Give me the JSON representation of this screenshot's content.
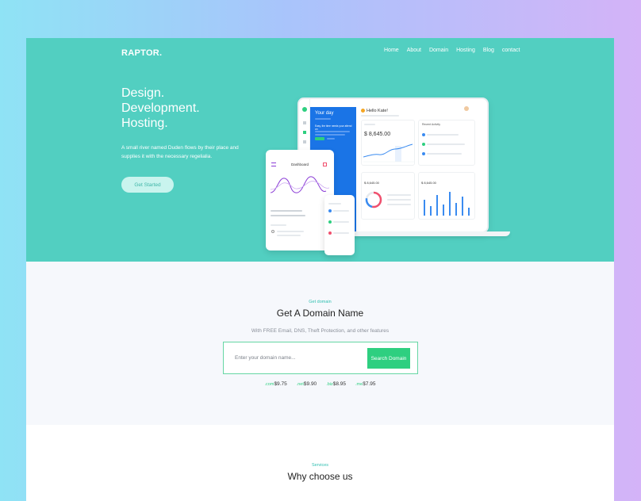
{
  "brand": {
    "logo": "RAPTOR."
  },
  "nav": {
    "items": [
      "Home",
      "About",
      "Domain",
      "Hosting",
      "Blog",
      "contact"
    ]
  },
  "hero": {
    "headline": [
      "Design.",
      "Development.",
      "Hosting."
    ],
    "description": "A small river named Duden flows by their place and supplies it with the necessary regelialia.",
    "cta_label": "Get Started"
  },
  "mockup": {
    "greeting": "Hello Kate!",
    "amount": "$ 8,645.00",
    "blue_title": "Your day",
    "blue_subtitle": "Easy, the time needs your attend on",
    "phone_title": "Dashboard",
    "totals_amount": "$ 8,645.00",
    "totals_amount_2": "$ 8,645.00",
    "recent_activity": "Recent Activity",
    "colors": {
      "hero_bg": "#52cfc1",
      "blue_panel": "#1a74e6",
      "chart_line": "#3a8bf0",
      "wave": "#8a3bd6"
    }
  },
  "domain": {
    "eyebrow": "Get domain",
    "title": "Get A Domain Name",
    "subtitle": "With FREE Email, DNS, Theft Protection, and other features",
    "input_placeholder": "Enter your domain name...",
    "button_label": "Search Domain",
    "prices": [
      {
        "tld": ".com",
        "price": "$9.75"
      },
      {
        "tld": ".net",
        "price": "$9.90"
      },
      {
        "tld": ".biz",
        "price": "$8.95"
      },
      {
        "tld": ".me",
        "price": "$7.95"
      }
    ]
  },
  "services": {
    "eyebrow": "Services",
    "title": "Why choose us"
  }
}
